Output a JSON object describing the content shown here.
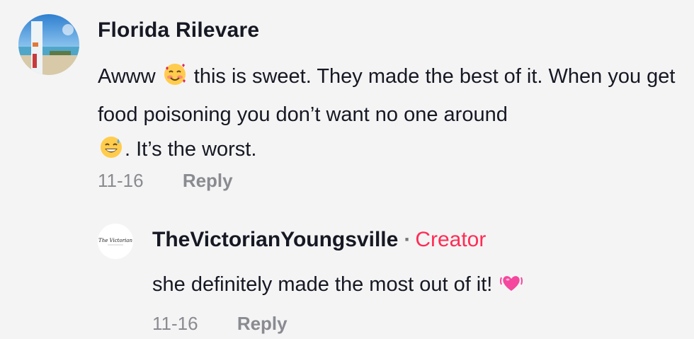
{
  "comments": [
    {
      "username": "Florida Rilevare",
      "text_parts": [
        "Awww",
        "this is sweet. They made the best of it. When you get food poisoning you don’t want no one around",
        ". It’s the worst."
      ],
      "emojis": [
        "smiling-face-with-hearts-icon",
        "grinning-face-with-sweat-icon"
      ],
      "date": "11-16",
      "reply_label": "Reply"
    }
  ],
  "replies": [
    {
      "username": "TheVictorianYoungsville",
      "separator": "·",
      "badge": "Creator",
      "avatar_text": "The Victorian",
      "text": "she definitely made the most out of it!",
      "emoji": "beating-heart-icon",
      "date": "11-16",
      "reply_label": "Reply"
    }
  ],
  "colors": {
    "background": "#f4f4f4",
    "text": "#161823",
    "muted": "#8a8b91",
    "creator_accent": "#fe2c55"
  }
}
